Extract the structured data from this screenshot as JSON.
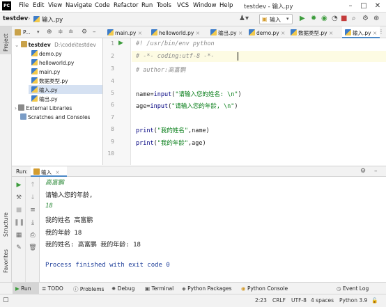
{
  "app": {
    "logo_text": "PC",
    "window_title": "testdev - 输入.py"
  },
  "menu": [
    "File",
    "Edit",
    "View",
    "Navigate",
    "Code",
    "Refactor",
    "Run",
    "Tools",
    "VCS",
    "Window",
    "Help"
  ],
  "navbar": {
    "project": "testdev",
    "file": "输入.py",
    "run_config": "输入"
  },
  "sidebar_strip": {
    "project_label": "Project",
    "structure_label": "Structure",
    "favorites_label": "Favorites"
  },
  "project_panel": {
    "header_label": "P...",
    "root_name": "testdev",
    "root_path": "D:\\code\\testdev",
    "files": [
      "demo.py",
      "helloworld.py",
      "main.py",
      "数据类型.py",
      "输入.py",
      "输出.py"
    ],
    "external_libraries": "External Libraries",
    "scratches": "Scratches and Consoles"
  },
  "tabs": [
    "main.py",
    "helloworld.py",
    "输出.py",
    "demo.py",
    "数据类型.py",
    "输入.py"
  ],
  "active_tab": "输入.py",
  "editor": {
    "line_numbers": [
      "1",
      "2",
      "3",
      "4",
      "5",
      "6",
      "7",
      "8",
      "9",
      "10"
    ],
    "lines": {
      "l1": "#! /usr/bin/env python",
      "l2": "# -*- coding:utf-8 -*-",
      "l3": "# author:高富鹏",
      "l5a": "name=",
      "l5b": "input",
      "l5c": "(",
      "l5d": "\"请输入您的姓名: \\n\"",
      "l5e": ")",
      "l6a": "age=",
      "l6b": "input",
      "l6c": "(",
      "l6d": "\"请输入您的年龄, \\n\"",
      "l6e": ")",
      "l8a": "print",
      "l8b": "(",
      "l8c": "\"我的姓名\"",
      "l8d": ",name)",
      "l9a": "print",
      "l9b": "(",
      "l9c": "\"我的年龄\"",
      "l9d": ",age)"
    }
  },
  "run_panel": {
    "label": "Run:",
    "tab": "输入",
    "console": [
      {
        "text": "高富鹏",
        "kind": "input"
      },
      {
        "text": "请输入您的年龄,",
        "kind": "out"
      },
      {
        "text": "18",
        "kind": "input"
      },
      {
        "text": "我的姓名 高富鹏",
        "kind": "out"
      },
      {
        "text": "我的年龄 18",
        "kind": "out"
      },
      {
        "text": "我的姓名: 高富鹏 我的年龄: 18",
        "kind": "out"
      },
      {
        "text": "",
        "kind": "out"
      },
      {
        "text": "Process finished with exit code 0",
        "kind": "exit"
      }
    ]
  },
  "tool_windows": [
    "Run",
    "TODO",
    "Problems",
    "Debug",
    "Terminal",
    "Python Packages",
    "Python Console"
  ],
  "event_log": "Event Log",
  "status": {
    "position": "2:23",
    "line_sep": "CRLF",
    "encoding": "UTF-8",
    "indent": "4 spaces",
    "interpreter": "Python 3.9"
  },
  "colors": {
    "keyword_blue": "#000080",
    "string_green": "#067d17",
    "comment_gray": "#8c8c8c",
    "input_green": "#2e8b3b",
    "exit_blue": "#1f3f9a"
  }
}
